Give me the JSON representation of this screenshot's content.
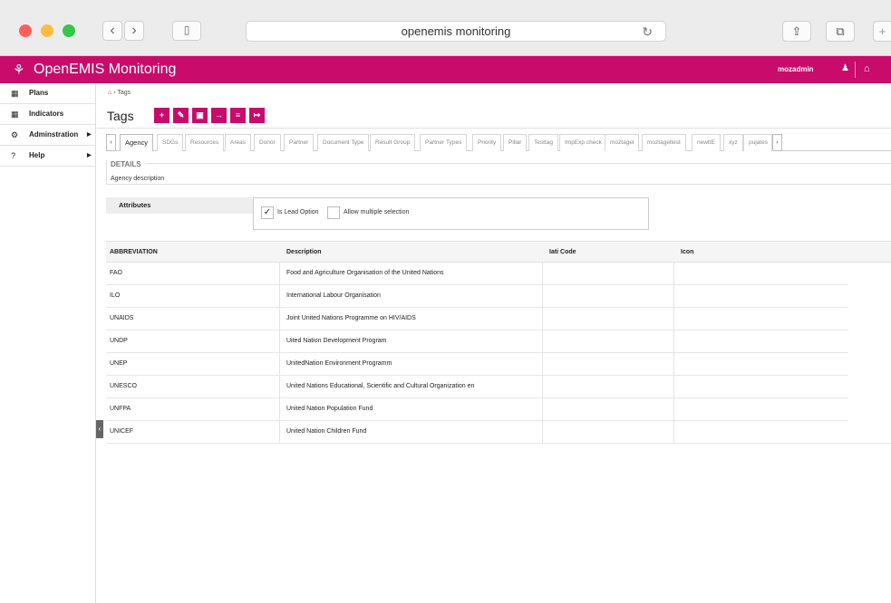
{
  "browser": {
    "url_title": "openemis monitoring",
    "back_glyph": "‹",
    "forward_glyph": "›",
    "sidebar_glyph": "▯",
    "reload_glyph": "↻",
    "share_glyph": "⇪",
    "tabs_glyph": "⧉",
    "new_tab_glyph": "+"
  },
  "header": {
    "logo_glyph": "⚘",
    "title": "OpenEMIS Monitoring",
    "user": "mozadmin",
    "user_glyph": "♟",
    "home_glyph": "⌂"
  },
  "sidebar": {
    "items": [
      {
        "label": "Plans",
        "icon": "▦",
        "arrow": ""
      },
      {
        "label": "Indicators",
        "icon": "▦",
        "arrow": ""
      },
      {
        "label": "Adminstration",
        "icon": "⚙",
        "arrow": "▶"
      },
      {
        "label": "Help",
        "icon": "?",
        "arrow": "▶"
      }
    ],
    "collapse_glyph": "‹"
  },
  "breadcrumb": {
    "home_glyph": "⌂",
    "sep": "›",
    "current": "Tags"
  },
  "page": {
    "title": "Tags"
  },
  "toolbar": {
    "add": "+",
    "edit": "✎",
    "delete": "▣",
    "import": "→",
    "list": "≡",
    "export": "↦"
  },
  "tabs": {
    "prev": "‹",
    "next": "›",
    "items": [
      "Agency",
      "SDGs",
      "Resources",
      "Areas",
      "Donor",
      "Partner",
      "Document Type",
      "Result Group",
      "Partner Types",
      "Priority",
      "Pillar",
      "Testtag",
      "ImpExp check",
      "moztagel",
      "moztageltest",
      "newttE",
      "xyz",
      "pujates"
    ],
    "active": "Agency"
  },
  "details": {
    "label": "DETAILS",
    "description": "Agency description"
  },
  "attributes": {
    "label": "Attributes",
    "options": [
      {
        "label": "Is Lead Option",
        "checked": "✓"
      },
      {
        "label": "Allow multiple selection",
        "checked": ""
      }
    ]
  },
  "table": {
    "headers": [
      "ABBREVIATION",
      "Description",
      "Iati Code",
      "Icon"
    ],
    "rows": [
      [
        "FAO",
        "Food and Agriculture Organisation of the United Nations",
        "",
        ""
      ],
      [
        "ILO",
        "International Labour Organisation",
        "",
        ""
      ],
      [
        "UNAIDS",
        "Joint United Nations Programme on HIV/AIDS",
        "",
        ""
      ],
      [
        "UNDP",
        "Uited Nation Development Program",
        "",
        ""
      ],
      [
        "UNEP",
        "UnitedNation Environment Programm",
        "",
        ""
      ],
      [
        "UNESCO",
        "United Nations Educational, Scientific and Cultural Organization en",
        "",
        ""
      ],
      [
        "UNFPA",
        "United Nation Population Fund",
        "",
        ""
      ],
      [
        "UNICEF",
        "United Nation Children Fund",
        "",
        ""
      ]
    ]
  },
  "colors": {
    "brand": "#c90b6b"
  }
}
